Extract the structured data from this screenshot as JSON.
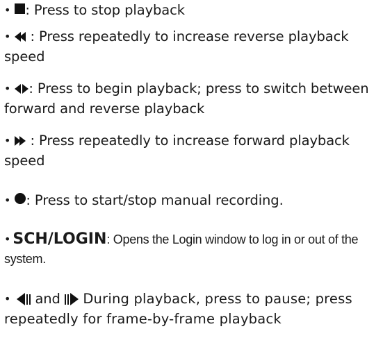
{
  "items": [
    {
      "icon": "stop-icon",
      "text": ": Press to stop playback"
    },
    {
      "icon": "rewind-icon",
      "text": " : Press repeatedly to increase reverse playback speed"
    },
    {
      "icon": "play-reverse-toggle-icon",
      "text": ": Press to begin playback; press to switch between forward and reverse playback"
    },
    {
      "icon": "fast-forward-icon",
      "text": " : Press repeatedly to increase forward playback speed"
    },
    {
      "icon": "record-icon",
      "text": ": Press to start/stop manual recording."
    },
    {
      "keyword": "SCH/LOGIN",
      "text": ": Opens the Login window to log in or out of the system."
    },
    {
      "icon": "frame-back-icon",
      "connector": " and ",
      "icon2": "frame-forward-icon",
      "text": "  During playback, press to pause; press repeatedly for frame-by-frame playback"
    }
  ],
  "bullet": "•"
}
